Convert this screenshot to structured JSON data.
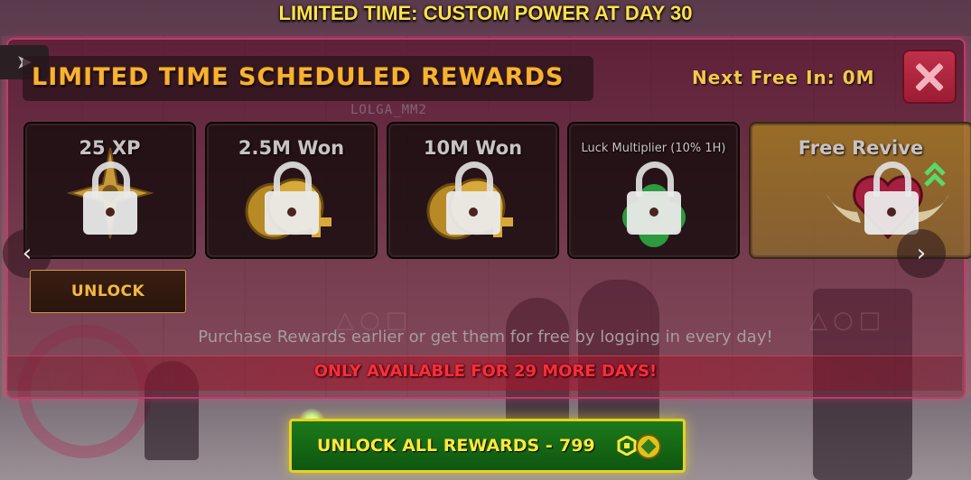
{
  "banner": {
    "text": "LIMITED TIME: CUSTOM POWER AT DAY 30"
  },
  "header": {
    "title": "LIMITED TIME SCHEDULED REWARDS",
    "next_free": "Next Free In: 0M",
    "watermark": "LOLGA_MM2"
  },
  "rewards": [
    {
      "label": "25 XP",
      "icon": "star-compass-icon",
      "locked": true
    },
    {
      "label": "2.5M Won",
      "icon": "coins-icon",
      "locked": true
    },
    {
      "label": "10M Won",
      "icon": "coins-icon",
      "locked": true
    },
    {
      "label": "Luck Multiplier (10% 1H)",
      "icon": "clover-icon",
      "locked": true
    },
    {
      "label": "Free Revive",
      "icon": "winged-heart-icon",
      "locked": true
    }
  ],
  "nav": {
    "prev_icon": "‹",
    "next_icon": "›"
  },
  "buttons": {
    "unlock": "UNLOCK",
    "unlock_all": "UNLOCK ALL REWARDS -",
    "price": "799"
  },
  "info": {
    "purchase_note": "Purchase Rewards earlier or get them for free by logging in every day!",
    "availability": "ONLY AVAILABLE FOR 29 MORE DAYS!"
  },
  "colors": {
    "accent_gold": "#f7b233",
    "warning_red": "#ff2d3a",
    "cta_green": "#1d7a1a",
    "cta_border": "#e8d21e",
    "close_red": "#c0304a"
  }
}
